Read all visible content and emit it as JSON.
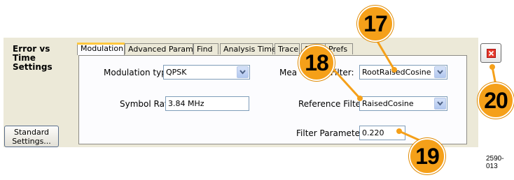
{
  "side": {
    "title": "Error vs Time Settings",
    "standard_button": "Standard Settings..."
  },
  "tabs": [
    "Modulation",
    "Advanced Params",
    "Find",
    "Analysis Time",
    "Trace",
    "Scale",
    "Prefs"
  ],
  "modulation": {
    "mod_type_label": "Modulation type:",
    "mod_type_value": "QPSK",
    "symbol_rate_label": "Symbol Rate:",
    "symbol_rate_value": "3.84 MHz",
    "meas_filter_label_a": "Mea",
    "meas_filter_label_b": "Filter:",
    "meas_filter_value": "RootRaisedCosine",
    "ref_filter_label": "Reference Filter:",
    "ref_filter_value": "RaisedCosine",
    "filter_param_label": "Filter Parameter:",
    "filter_param_value": "0.220"
  },
  "callouts": [
    "17",
    "18",
    "19",
    "20"
  ],
  "figure_id": "2590-013",
  "colors": {
    "callout": "#f5a019",
    "panel": "#ece9d8",
    "close": "#e53a2c"
  }
}
